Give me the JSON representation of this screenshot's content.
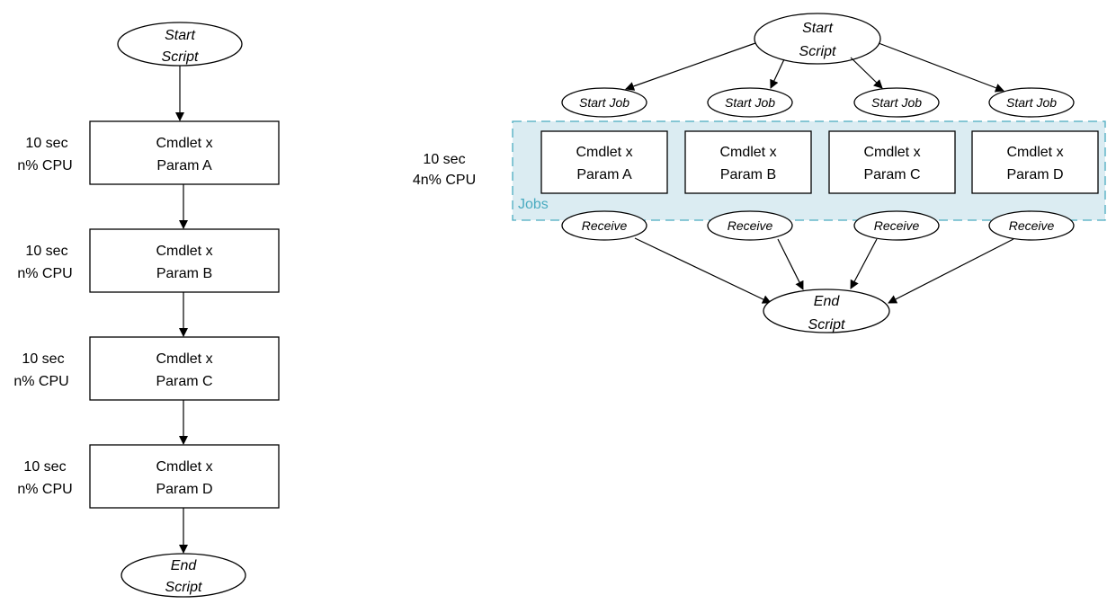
{
  "sequential": {
    "start": [
      "Start",
      "Script"
    ],
    "end": [
      "End",
      "Script"
    ],
    "steps": [
      {
        "cost": [
          "10 sec",
          "n% CPU"
        ],
        "label": [
          "Cmdlet x",
          "Param A"
        ]
      },
      {
        "cost": [
          "10 sec",
          "n% CPU"
        ],
        "label": [
          "Cmdlet x",
          "Param B"
        ]
      },
      {
        "cost": [
          "10 sec",
          "n% CPU"
        ],
        "label": [
          "Cmdlet x",
          "Param C"
        ]
      },
      {
        "cost": [
          "10 sec",
          "n% CPU"
        ],
        "label": [
          "Cmdlet x",
          "Param D"
        ]
      }
    ]
  },
  "parallel": {
    "start": [
      "Start",
      "Script"
    ],
    "end": [
      "End",
      "Script"
    ],
    "cost": [
      "10 sec",
      "4n% CPU"
    ],
    "group_label": "Jobs",
    "group_color": "#dbecf2",
    "group_border": "#4aabc0",
    "start_job_label": "Start Job",
    "receive_label": "Receive",
    "jobs": [
      {
        "label": [
          "Cmdlet x",
          "Param A"
        ]
      },
      {
        "label": [
          "Cmdlet x",
          "Param B"
        ]
      },
      {
        "label": [
          "Cmdlet x",
          "Param C"
        ]
      },
      {
        "label": [
          "Cmdlet x",
          "Param D"
        ]
      }
    ]
  }
}
